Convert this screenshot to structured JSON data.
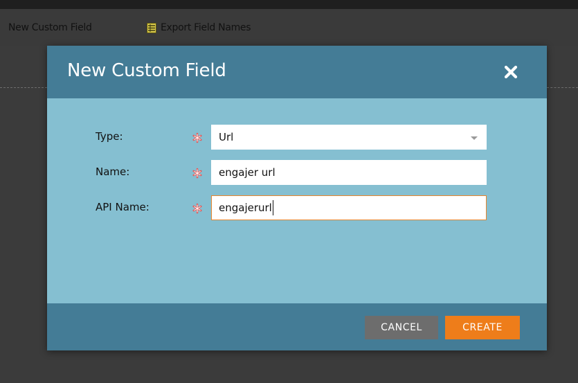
{
  "toolbar": {
    "new_custom_field_label": "New Custom Field",
    "export_field_names_label": "Export Field Names",
    "export_icon": "spreadsheet-icon"
  },
  "dialog": {
    "title": "New Custom Field",
    "close_icon": "close-icon",
    "fields": {
      "type": {
        "label": "Type:",
        "value": "Url",
        "required": true
      },
      "name": {
        "label": "Name:",
        "value": "engajer url",
        "required": true
      },
      "api_name": {
        "label": "API Name:",
        "value": "engajerurl",
        "required": true
      }
    },
    "buttons": {
      "cancel_label": "CANCEL",
      "create_label": "CREATE"
    }
  },
  "colors": {
    "dialog_header": "#447c96",
    "dialog_body": "#85bfd1",
    "primary_button": "#ee7d1a",
    "secondary_button": "#6d6d6d",
    "required_marker": "#e05a5a",
    "focus_border": "#e8842b",
    "background": "#3b3b3b"
  }
}
